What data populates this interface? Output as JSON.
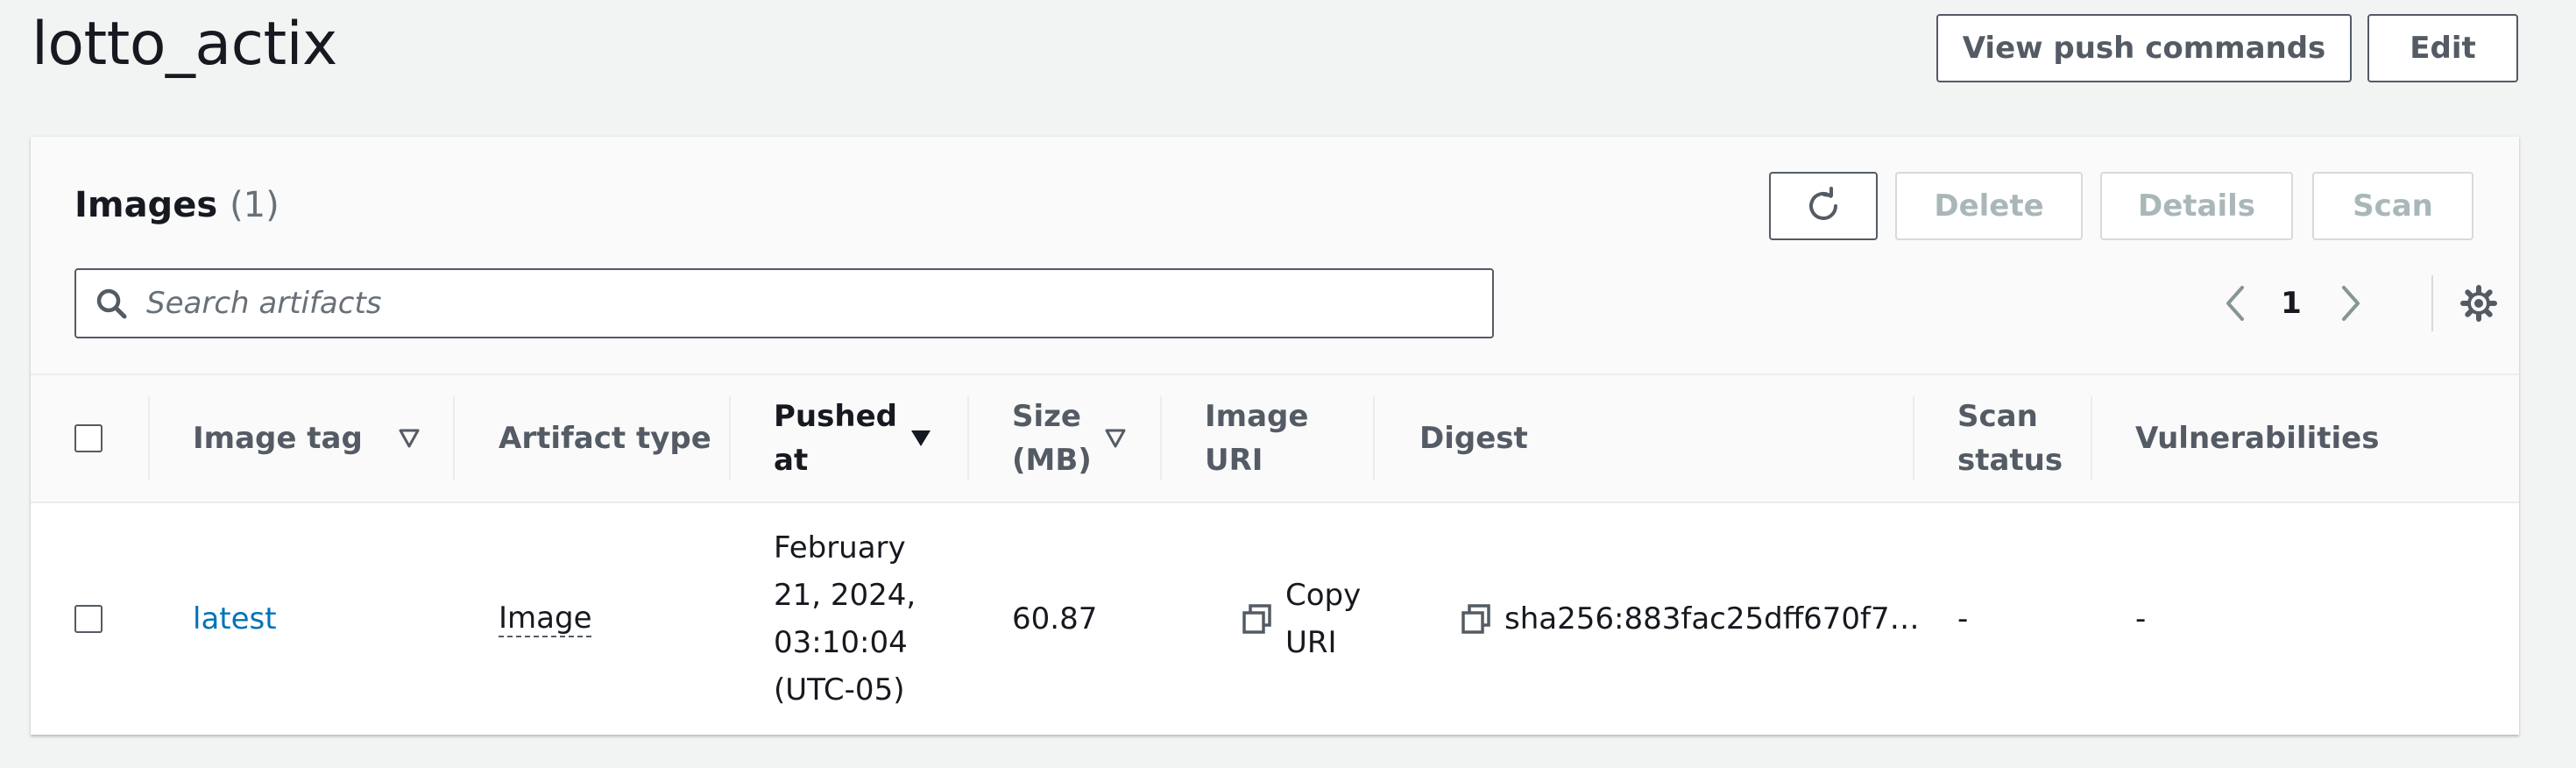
{
  "page": {
    "title": "lotto_actix"
  },
  "header_actions": {
    "view_push_commands": "View push commands",
    "edit": "Edit"
  },
  "panel": {
    "title": "Images",
    "count": "(1)",
    "actions": {
      "refresh_icon": "refresh-icon",
      "delete": "Delete",
      "details": "Details",
      "scan": "Scan"
    },
    "search": {
      "placeholder": "Search artifacts",
      "value": ""
    },
    "pagination": {
      "current_page": "1"
    }
  },
  "table": {
    "columns": {
      "image_tag": "Image tag",
      "artifact_type": "Artifact type",
      "pushed_at_line1": "Pushed",
      "pushed_at_line2": "at",
      "size_line1": "Size",
      "size_line2": "(MB)",
      "image_uri_line1": "Image",
      "image_uri_line2": "URI",
      "digest": "Digest",
      "scan_status_line1": "Scan",
      "scan_status_line2": "status",
      "vulnerabilities": "Vulnerabilities"
    },
    "rows": [
      {
        "image_tag": "latest",
        "artifact_type": "Image",
        "pushed_at_lines": [
          "February",
          "21, 2024,",
          "03:10:04",
          "(UTC-05)"
        ],
        "size": "60.87",
        "image_uri_lines": [
          "Copy",
          "URI"
        ],
        "digest": "sha256:883fac25dff670f7…",
        "scan_status": "-",
        "vulnerabilities": "-"
      }
    ]
  },
  "colors": {
    "page_background": "#f2f3f3",
    "link": "#0073bb",
    "text": "#16191f",
    "muted": "#545b64",
    "disabled": "#aab7b8"
  }
}
